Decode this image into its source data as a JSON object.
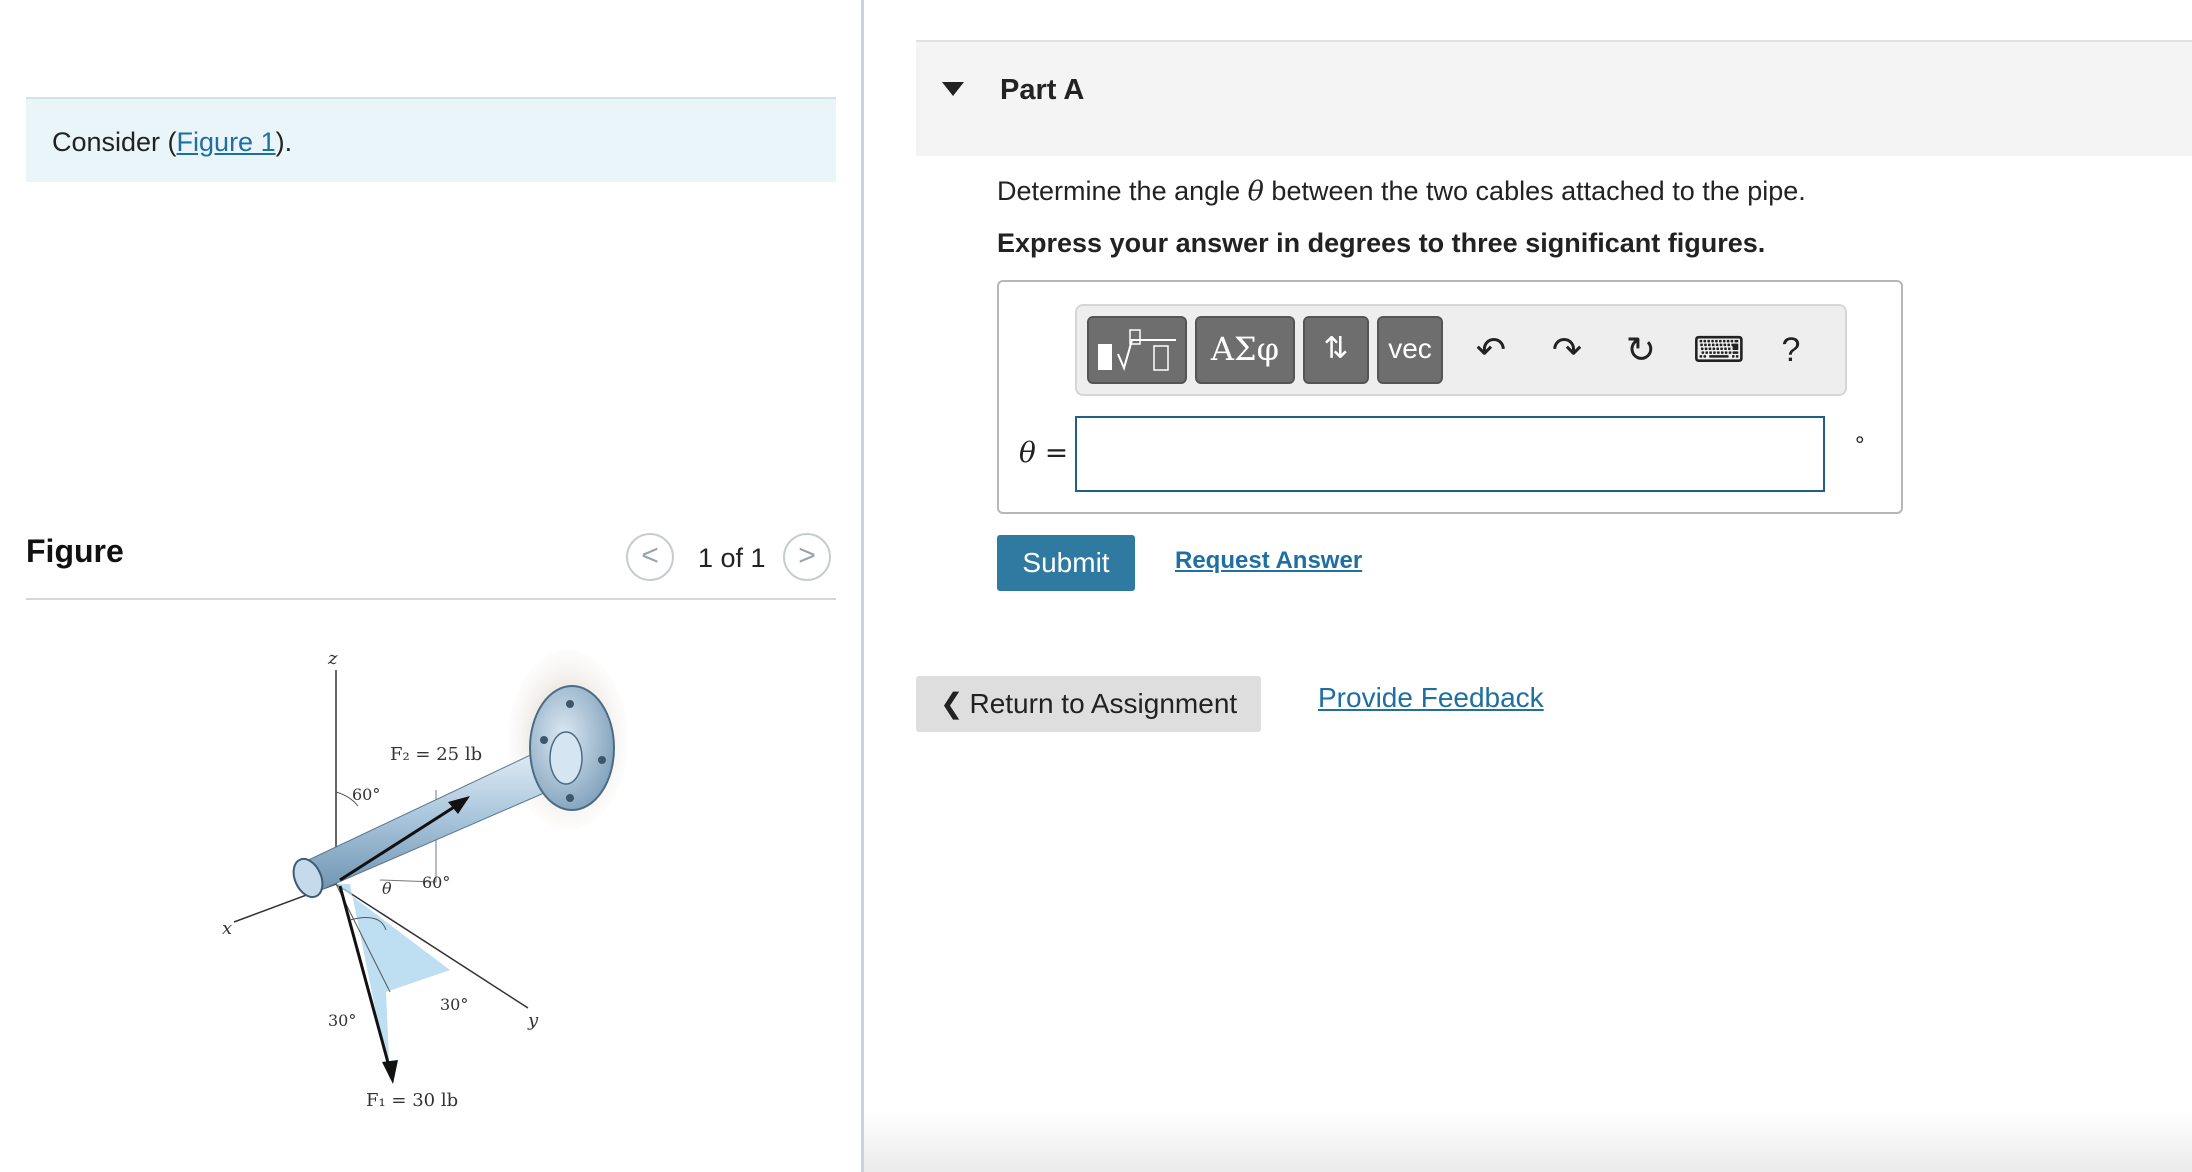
{
  "left": {
    "intro": {
      "prefix": "Consider (",
      "link": "Figure 1",
      "suffix": ")."
    },
    "figure": {
      "title": "Figure",
      "pager": "1 of 1",
      "prev_icon": "<",
      "next_icon": ">",
      "labels": {
        "z": "z",
        "x": "x",
        "y": "y",
        "f2": "F₂ = 25 lb",
        "f1": "F₁ = 30 lb",
        "angle_60_top": "60°",
        "angle_60_mid": "60°",
        "theta": "θ",
        "angle_30_left": "30°",
        "angle_30_right": "30°"
      }
    }
  },
  "part": {
    "title": "Part A",
    "question_prefix": "Determine the angle ",
    "question_symbol": "θ",
    "question_suffix": " between the two cables attached to the pipe.",
    "instruction": "Express your answer in degrees to three significant figures.",
    "toolbar": {
      "templates_icon": "▮√⎕",
      "greek_label": "ΑΣφ",
      "arrows_label": "⇅",
      "vec_label": "vec",
      "undo_icon": "↶",
      "redo_icon": "↷",
      "reset_icon": "↻",
      "keyboard_icon": "⌨",
      "help_label": "?"
    },
    "variable_label": "θ =",
    "input_value": "",
    "unit": "°",
    "submit_label": "Submit",
    "request_label": "Request Answer"
  },
  "footer": {
    "return_label": "Return to Assignment",
    "return_icon": "❮",
    "feedback_label": "Provide Feedback"
  }
}
